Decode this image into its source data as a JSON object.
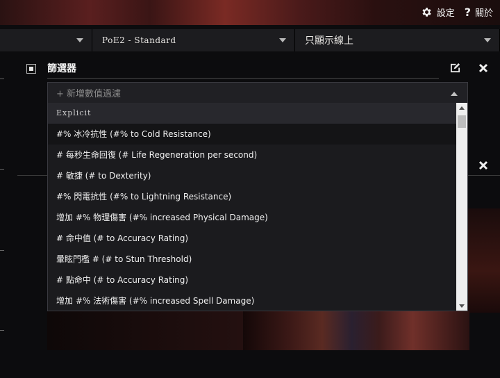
{
  "topbar": {
    "settings_label": "設定",
    "about_label": "關於"
  },
  "selects": {
    "league_value": "PoE2 - Standard",
    "online_value": "只顯示線上"
  },
  "filter": {
    "title": "篩選器",
    "search_placeholder": "+ 新增數值過濾",
    "group_header": "Explicit",
    "options": [
      "#% 冰冷抗性 (#% to Cold Resistance)",
      "# 每秒生命回復 (# Life Regeneration per second)",
      "# 敏捷 (# to Dexterity)",
      "#% 閃電抗性 (#% to Lightning Resistance)",
      "增加 #% 物理傷害 (#% increased Physical Damage)",
      "# 命中值 (# to Accuracy Rating)",
      "暈眩門檻 # (# to Stun Threshold)",
      "# 點命中 (# to Accuracy Rating)",
      "增加 #% 法術傷害 (#% increased Spell Damage)"
    ]
  },
  "icons": {
    "settings": "gear-icon",
    "about": "question-icon",
    "edit": "edit-icon",
    "close": "close-icon"
  }
}
